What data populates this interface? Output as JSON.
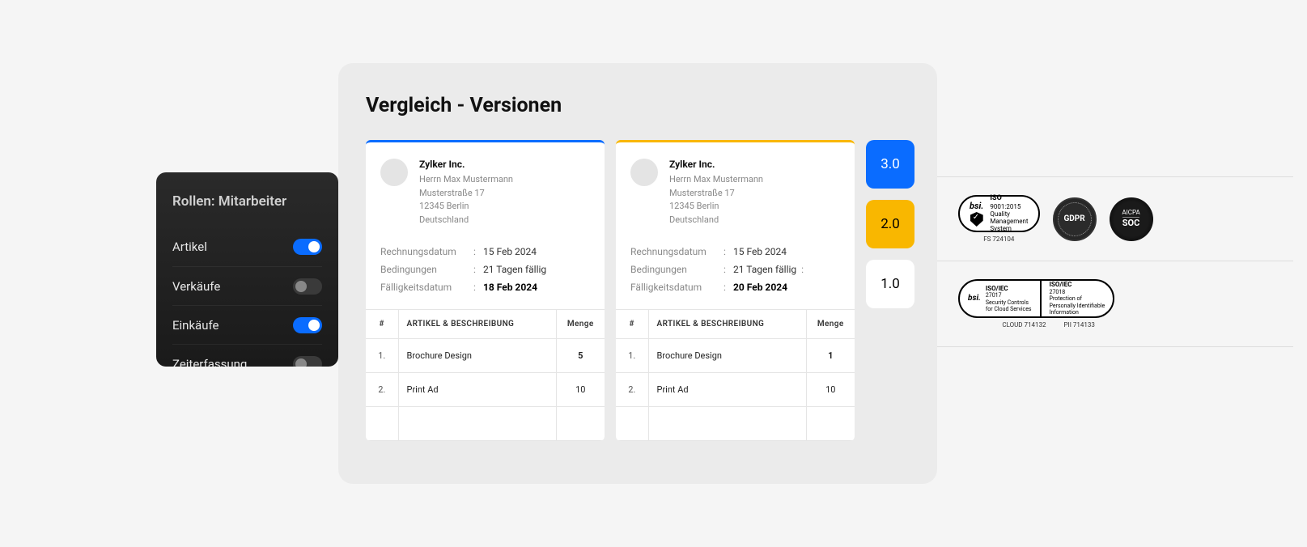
{
  "roles": {
    "title": "Rollen: Mitarbeiter",
    "items": [
      {
        "label": "Artikel",
        "on": true
      },
      {
        "label": "Verkäufe",
        "on": false
      },
      {
        "label": "Einkäufe",
        "on": true
      },
      {
        "label": "Zeiterfassung",
        "on": false
      }
    ]
  },
  "compare": {
    "title": "Vergleich - Versionen",
    "versions": [
      {
        "label": "3.0",
        "variant": "v3"
      },
      {
        "label": "2.0",
        "variant": "v2"
      },
      {
        "label": "1.0",
        "variant": "v1"
      }
    ],
    "docs": [
      {
        "variant": "v1",
        "company": "Zylker Inc.",
        "contact": "Herrn Max Mustermann",
        "street": "Musterstraße 17",
        "city": "12345 Berlin",
        "country": "Deutschland",
        "fields": {
          "rechnungsdatum_label": "Rechnungsdatum",
          "rechnungsdatum_value": "15 Feb 2024",
          "bedingungen_label": "Bedingungen",
          "bedingungen_value": "21 Tagen fällig",
          "faelligkeitsdatum_label": "Fälligkeitsdatum",
          "faelligkeitsdatum_value": "18 Feb 2024",
          "due_bold": true,
          "trailing_colon": false
        },
        "table": {
          "headers": {
            "idx": "#",
            "desc": "ARTIKEL & BESCHREIBUNG",
            "qty": "Menge"
          },
          "rows": [
            {
              "idx": "1.",
              "desc": "Brochure Design",
              "qty": "5",
              "qty_bold": true
            },
            {
              "idx": "2.",
              "desc": "Print Ad",
              "qty": "10",
              "qty_bold": false
            }
          ]
        }
      },
      {
        "variant": "v2",
        "company": "Zylker Inc.",
        "contact": "Herrn Max Mustermann",
        "street": "Musterstraße 17",
        "city": "12345 Berlin",
        "country": "Deutschland",
        "fields": {
          "rechnungsdatum_label": "Rechnungsdatum",
          "rechnungsdatum_value": "15 Feb 2024",
          "bedingungen_label": "Bedingungen",
          "bedingungen_value": "21 Tagen fällig",
          "faelligkeitsdatum_label": "Fälligkeitsdatum",
          "faelligkeitsdatum_value": "20 Feb 2024",
          "due_bold": true,
          "trailing_colon": true
        },
        "table": {
          "headers": {
            "idx": "#",
            "desc": "ARTIKEL & BESCHREIBUNG",
            "qty": "Menge"
          },
          "rows": [
            {
              "idx": "1.",
              "desc": "Brochure Design",
              "qty": "1",
              "qty_bold": true
            },
            {
              "idx": "2.",
              "desc": "Print Ad",
              "qty": "10",
              "qty_bold": false
            }
          ]
        }
      }
    ]
  },
  "badges": {
    "iso9001": {
      "kicker": "bsi.",
      "top": "ISO",
      "line1": "9001:2015",
      "line2": "Quality",
      "line3": "Management",
      "line4": "System",
      "sub": "FS 724104"
    },
    "gdpr": {
      "label": "GDPR"
    },
    "soc": {
      "line1": "AICPA",
      "line2": "SOC"
    },
    "iso27017": {
      "kicker": "bsi.",
      "top": "ISO/IEC",
      "line1": "27017",
      "line2": "Security Controls",
      "line3": "for Cloud Services",
      "sub": "CLOUD 714132"
    },
    "iso27018": {
      "top": "ISO/IEC",
      "line1": "27018",
      "line2": "Protection of",
      "line3": "Personally Identifiable",
      "line4": "Information",
      "sub": "PII 714133"
    }
  }
}
